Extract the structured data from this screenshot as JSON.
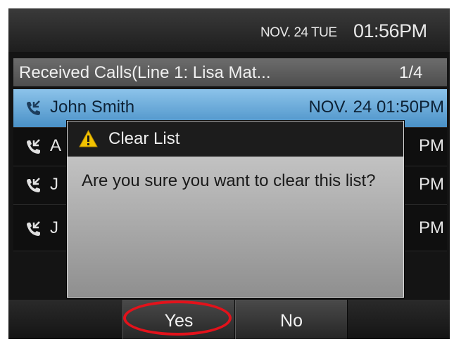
{
  "status_bar": {
    "date": "NOV. 24 TUE",
    "time": "01:56PM"
  },
  "list": {
    "title": "Received Calls(Line 1: Lisa Mat...",
    "page": "1/4",
    "rows": [
      {
        "name": "John Smith",
        "when": "NOV. 24 01:50PM",
        "icon": "received-call-icon",
        "selected": true
      },
      {
        "name": "A",
        "when": "PM",
        "icon": "received-call-icon"
      },
      {
        "name": "J",
        "when": "PM",
        "icon": "received-call-icon"
      },
      {
        "name": "J",
        "when": "PM",
        "icon": "received-call-icon"
      }
    ]
  },
  "dialog": {
    "title": "Clear List",
    "icon": "warning-icon",
    "message": "Are you sure you want to clear this list?"
  },
  "softkeys": {
    "yes": "Yes",
    "no": "No"
  },
  "colors": {
    "selection": "#5aa0d2",
    "warning": "#f2c200",
    "highlight": "#e3121b"
  }
}
